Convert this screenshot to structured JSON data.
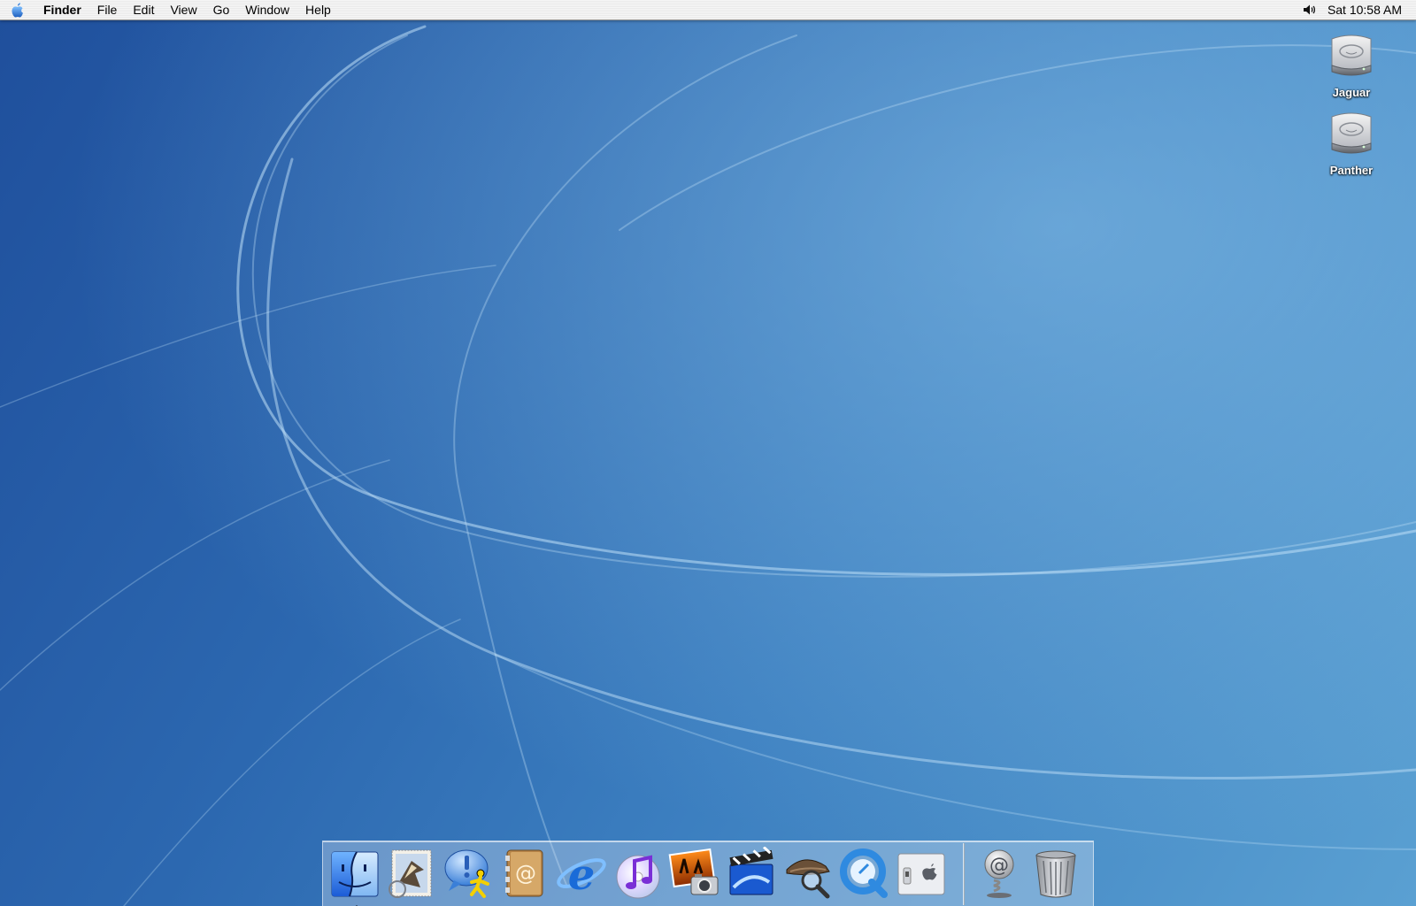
{
  "menubar": {
    "app_name": "Finder",
    "items": [
      "File",
      "Edit",
      "View",
      "Go",
      "Window",
      "Help"
    ],
    "clock": "Sat 10:58 AM"
  },
  "desktop": {
    "drives": [
      {
        "label": "Jaguar",
        "icon": "hard-drive-icon"
      },
      {
        "label": "Panther",
        "icon": "hard-drive-icon"
      }
    ]
  },
  "dock": {
    "apps": [
      {
        "name": "Finder",
        "icon": "finder-icon",
        "running": true
      },
      {
        "name": "Mail",
        "icon": "mail-icon"
      },
      {
        "name": "iChat",
        "icon": "ichat-icon"
      },
      {
        "name": "Address Book",
        "icon": "address-book-icon"
      },
      {
        "name": "Internet Explorer",
        "icon": "internet-explorer-icon"
      },
      {
        "name": "iTunes",
        "icon": "itunes-icon"
      },
      {
        "name": "iPhoto",
        "icon": "iphoto-icon"
      },
      {
        "name": "iMovie",
        "icon": "imovie-icon"
      },
      {
        "name": "Sherlock",
        "icon": "sherlock-icon"
      },
      {
        "name": "QuickTime Player",
        "icon": "quicktime-icon"
      },
      {
        "name": "System Preferences",
        "icon": "system-preferences-icon"
      }
    ],
    "extras": [
      {
        "name": "Internet Connect",
        "icon": "internet-connect-icon"
      },
      {
        "name": "Trash",
        "icon": "trash-icon"
      }
    ]
  },
  "colors": {
    "wallpaper_dark": "#1f4f9c",
    "wallpaper_light": "#5aa0d2",
    "menubar": "#eeeeee"
  }
}
